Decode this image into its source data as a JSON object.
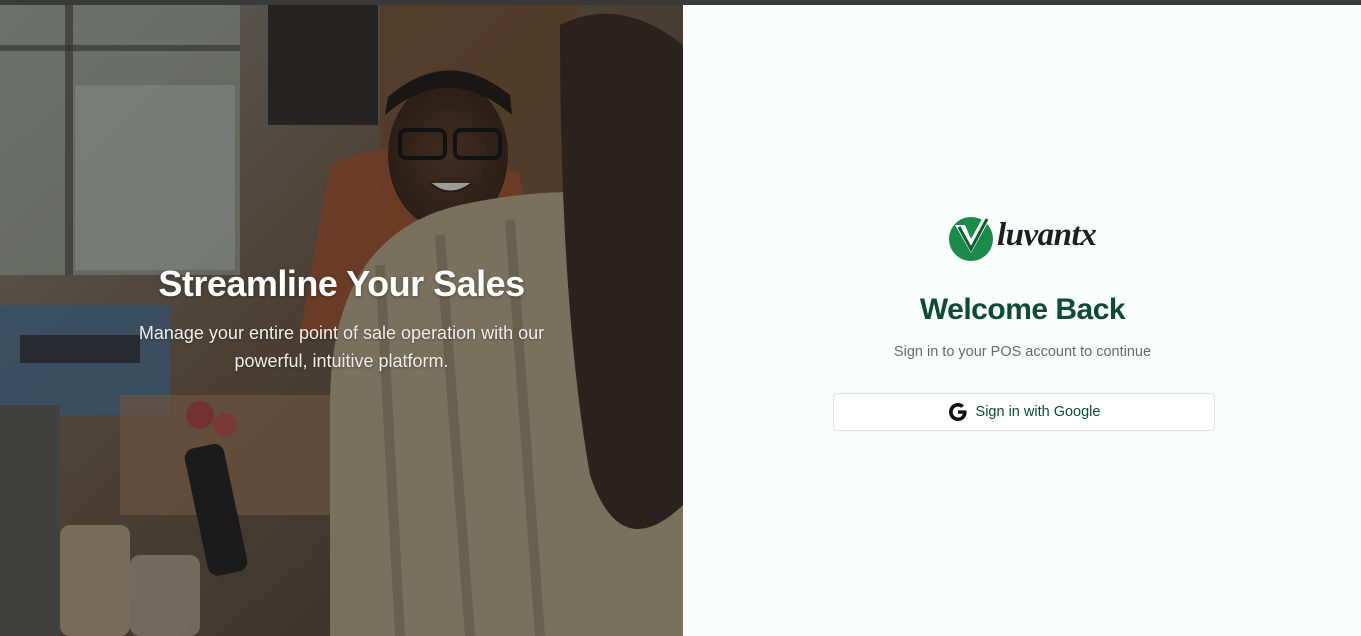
{
  "hero": {
    "title": "Streamline Your Sales",
    "subtitle": "Manage your entire point of sale operation with our powerful, intuitive platform."
  },
  "brand": {
    "name": "luvantx",
    "colors": {
      "primary": "#0f4a36",
      "logo_green": "#1b8a4a"
    }
  },
  "login": {
    "title": "Welcome Back",
    "subtitle": "Sign in to your POS account to continue",
    "google_button_label": "Sign in with Google",
    "google_icon": "google-g-icon"
  }
}
